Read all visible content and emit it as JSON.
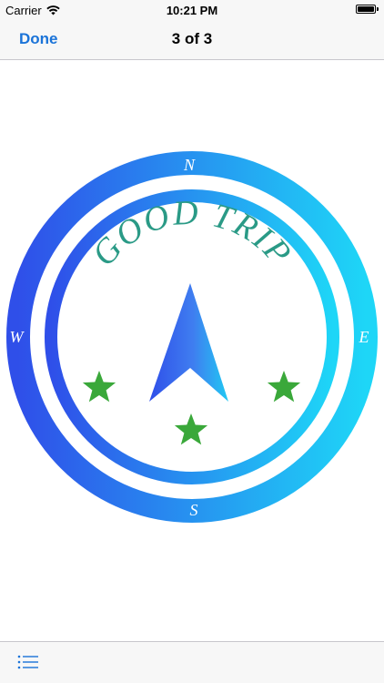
{
  "status_bar": {
    "carrier": "Carrier",
    "time": "10:21 PM",
    "battery_level": 1.0
  },
  "nav": {
    "done_label": "Done",
    "title": "3 of 3"
  },
  "logo": {
    "heading": "GOOD TRIP",
    "compass_points": {
      "north": "N",
      "south": "S",
      "east": "E",
      "west": "W"
    },
    "star_count": 3,
    "colors": {
      "ring_start": "#2f4fe9",
      "ring_end": "#1ed6f7",
      "heading": "#2a9a86",
      "star": "#3aa83a",
      "letters": "#ffffff"
    }
  },
  "toolbar": {
    "list_icon": "list-icon",
    "accent": "#1a73d8"
  }
}
